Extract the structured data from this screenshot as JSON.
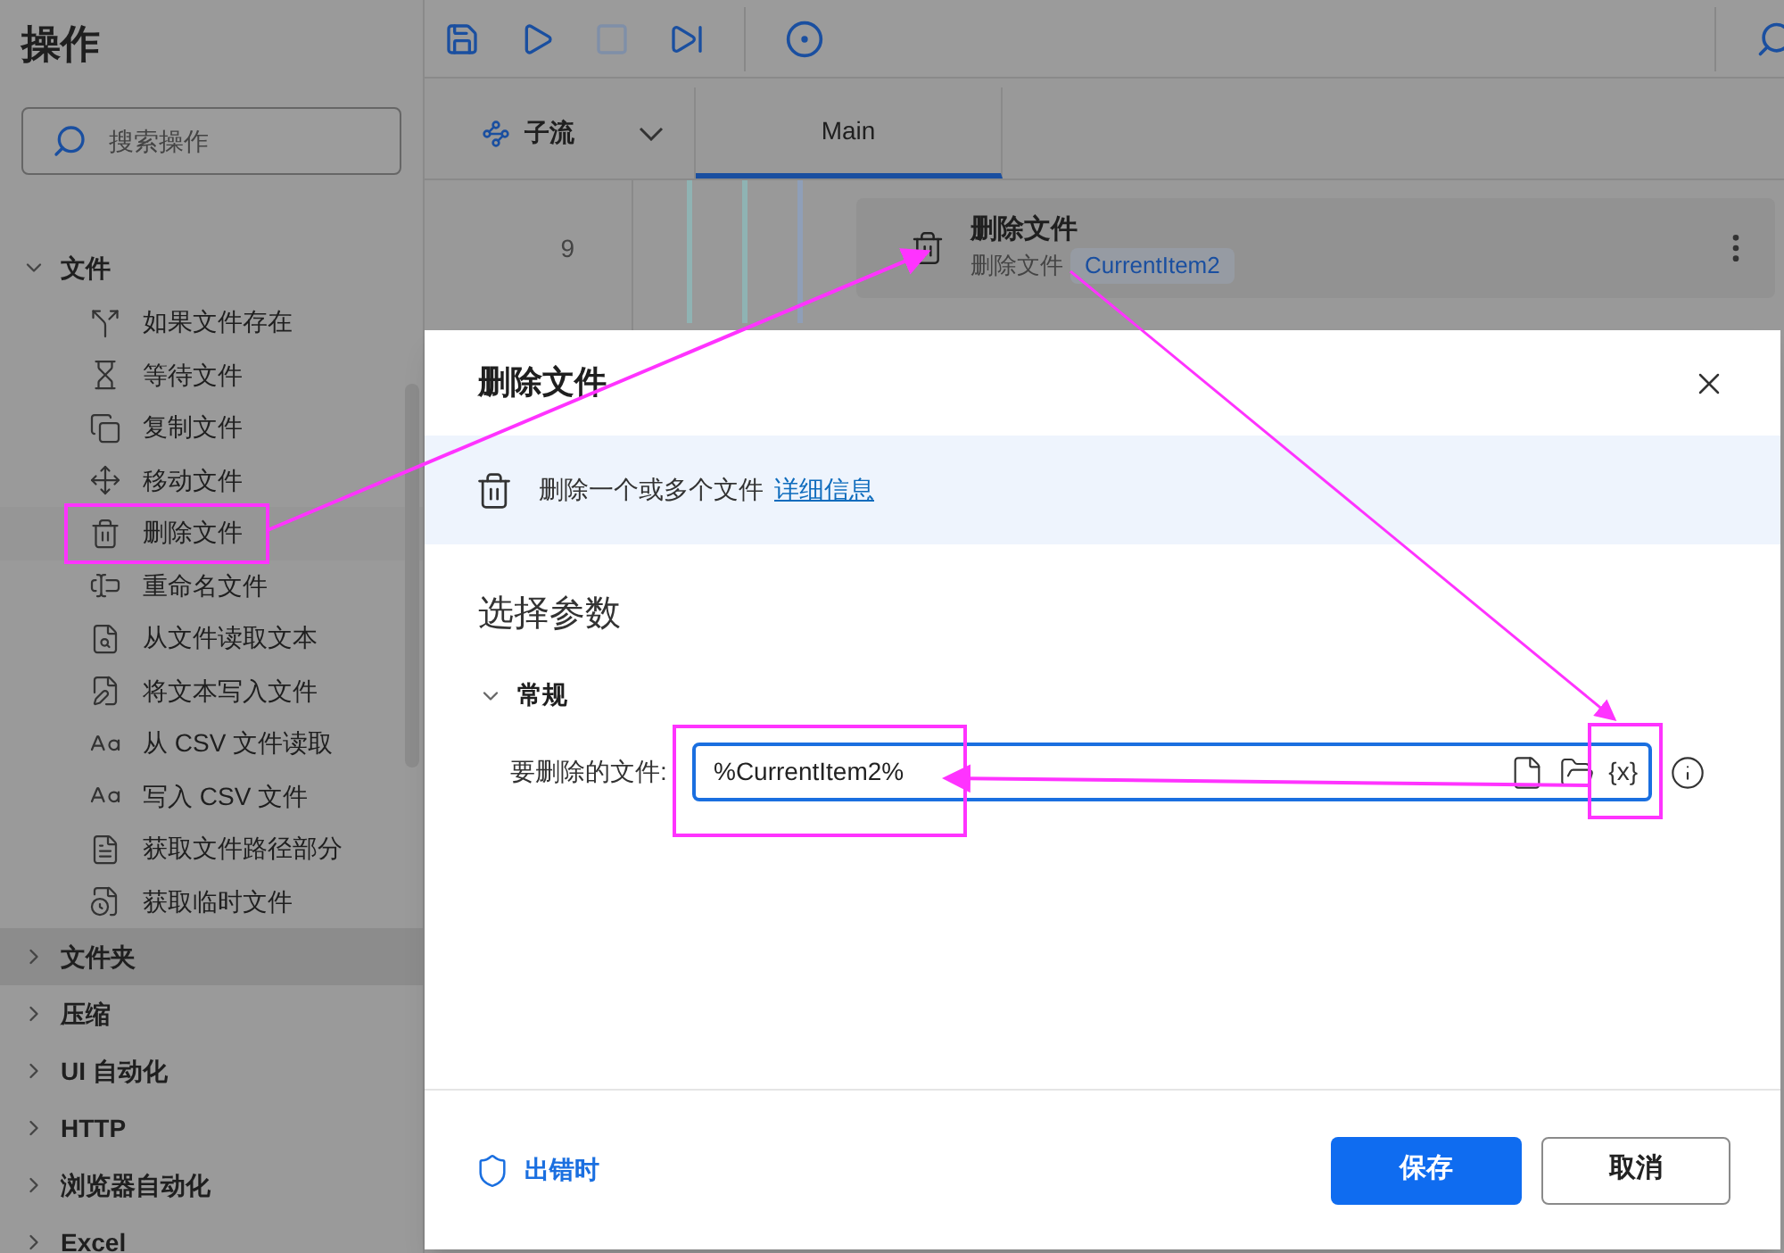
{
  "sidebar": {
    "title": "操作",
    "search": {
      "placeholder": "搜索操作"
    },
    "groups": [
      {
        "label": "文件",
        "expanded": true,
        "selected": false,
        "children": [
          {
            "label": "如果文件存在",
            "selected": false
          },
          {
            "label": "等待文件",
            "selected": false
          },
          {
            "label": "复制文件",
            "selected": false
          },
          {
            "label": "移动文件",
            "selected": false
          },
          {
            "label": "删除文件",
            "selected": true
          },
          {
            "label": "重命名文件",
            "selected": false
          },
          {
            "label": "从文件读取文本",
            "selected": false
          },
          {
            "label": "将文本写入文件",
            "selected": false
          },
          {
            "label": "从 CSV 文件读取",
            "selected": false
          },
          {
            "label": "写入 CSV 文件",
            "selected": false
          },
          {
            "label": "获取文件路径部分",
            "selected": false
          },
          {
            "label": "获取临时文件",
            "selected": false
          }
        ]
      },
      {
        "label": "文件夹",
        "expanded": false,
        "selected": true
      },
      {
        "label": "压缩",
        "expanded": false,
        "selected": false
      },
      {
        "label": "UI 自动化",
        "expanded": false,
        "selected": false
      },
      {
        "label": "HTTP",
        "expanded": false,
        "selected": false
      },
      {
        "label": "浏览器自动化",
        "expanded": false,
        "selected": false
      },
      {
        "label": "Excel",
        "expanded": false,
        "selected": false
      }
    ]
  },
  "tabs": [
    {
      "kind": "subflow",
      "label": "子流",
      "selected": false
    },
    {
      "kind": "tab",
      "label": "Main",
      "selected": true
    }
  ],
  "step": {
    "line": "9",
    "title": "删除文件",
    "subtitle": "删除文件",
    "variable": "CurrentItem2"
  },
  "dialog": {
    "title": "删除文件",
    "description": "删除一个或多个文件",
    "link": "详细信息",
    "section": "选择参数",
    "group": {
      "label": "常规",
      "expanded": true
    },
    "field": {
      "label": "要删除的文件:",
      "value": "%CurrentItem2%",
      "variable_button": "{x}"
    },
    "on_error": "出错时",
    "buttons": [
      {
        "label": "保存",
        "kind": "primary"
      },
      {
        "label": "取消",
        "kind": "secondary"
      }
    ]
  }
}
